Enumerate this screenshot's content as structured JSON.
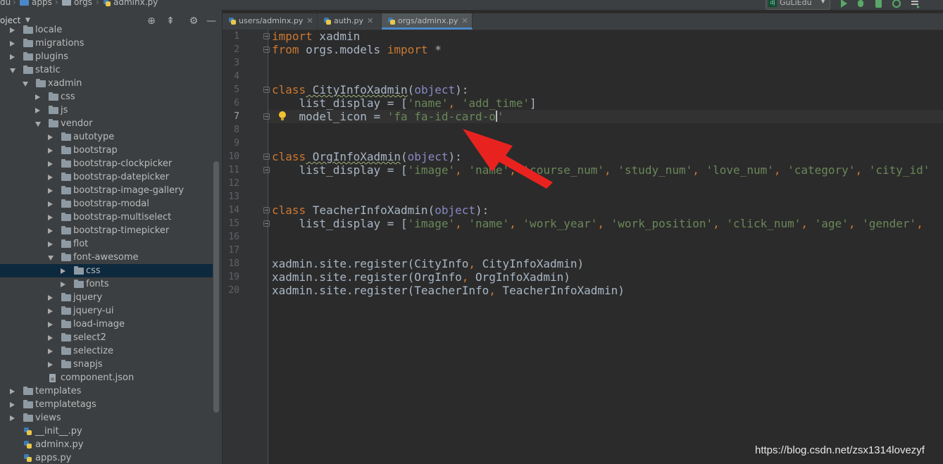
{
  "breadcrumb": {
    "part_0": "du",
    "part_1": "apps",
    "part_2": "orgs",
    "part_3": "adminx.py"
  },
  "toolbar": {
    "run_config": "GuLiEdu"
  },
  "project_panel": {
    "title": "oject",
    "tree": [
      {
        "label": "locale",
        "indent": 1,
        "expand": "right",
        "type": "folder"
      },
      {
        "label": "migrations",
        "indent": 1,
        "expand": "right",
        "type": "folder"
      },
      {
        "label": "plugins",
        "indent": 1,
        "expand": "right",
        "type": "folder"
      },
      {
        "label": "static",
        "indent": 1,
        "expand": "down",
        "type": "folder"
      },
      {
        "label": "xadmin",
        "indent": 2,
        "expand": "down",
        "type": "folder"
      },
      {
        "label": "css",
        "indent": 3,
        "expand": "right",
        "type": "folder"
      },
      {
        "label": "js",
        "indent": 3,
        "expand": "right",
        "type": "folder"
      },
      {
        "label": "vendor",
        "indent": 3,
        "expand": "down",
        "type": "folder"
      },
      {
        "label": "autotype",
        "indent": 4,
        "expand": "right",
        "type": "folder"
      },
      {
        "label": "bootstrap",
        "indent": 4,
        "expand": "right",
        "type": "folder"
      },
      {
        "label": "bootstrap-clockpicker",
        "indent": 4,
        "expand": "right",
        "type": "folder"
      },
      {
        "label": "bootstrap-datepicker",
        "indent": 4,
        "expand": "right",
        "type": "folder"
      },
      {
        "label": "bootstrap-image-gallery",
        "indent": 4,
        "expand": "right",
        "type": "folder"
      },
      {
        "label": "bootstrap-modal",
        "indent": 4,
        "expand": "right",
        "type": "folder"
      },
      {
        "label": "bootstrap-multiselect",
        "indent": 4,
        "expand": "right",
        "type": "folder"
      },
      {
        "label": "bootstrap-timepicker",
        "indent": 4,
        "expand": "right",
        "type": "folder"
      },
      {
        "label": "flot",
        "indent": 4,
        "expand": "right",
        "type": "folder"
      },
      {
        "label": "font-awesome",
        "indent": 4,
        "expand": "down",
        "type": "folder"
      },
      {
        "label": "css",
        "indent": 5,
        "expand": "right",
        "type": "folder",
        "selected": true
      },
      {
        "label": "fonts",
        "indent": 5,
        "expand": "right",
        "type": "folder"
      },
      {
        "label": "jquery",
        "indent": 4,
        "expand": "right",
        "type": "folder"
      },
      {
        "label": "jquery-ui",
        "indent": 4,
        "expand": "right",
        "type": "folder"
      },
      {
        "label": "load-image",
        "indent": 4,
        "expand": "right",
        "type": "folder"
      },
      {
        "label": "select2",
        "indent": 4,
        "expand": "right",
        "type": "folder"
      },
      {
        "label": "selectize",
        "indent": 4,
        "expand": "right",
        "type": "folder"
      },
      {
        "label": "snapjs",
        "indent": 4,
        "expand": "right",
        "type": "folder"
      },
      {
        "label": "component.json",
        "indent": 3,
        "expand": "none",
        "type": "json"
      },
      {
        "label": "templates",
        "indent": 1,
        "expand": "right",
        "type": "folder"
      },
      {
        "label": "templatetags",
        "indent": 1,
        "expand": "right",
        "type": "folder"
      },
      {
        "label": "views",
        "indent": 1,
        "expand": "right",
        "type": "folder"
      },
      {
        "label": "__init__.py",
        "indent": 1,
        "expand": "none",
        "type": "py"
      },
      {
        "label": "adminx.py",
        "indent": 1,
        "expand": "none",
        "type": "py"
      },
      {
        "label": "apps.py",
        "indent": 1,
        "expand": "none",
        "type": "py"
      }
    ]
  },
  "tabs": [
    {
      "label": "users/adminx.py",
      "active": false
    },
    {
      "label": "auth.py",
      "active": false
    },
    {
      "label": "orgs/adminx.py",
      "active": true
    }
  ],
  "editor": {
    "line_numbers": [
      "1",
      "2",
      "3",
      "4",
      "5",
      "6",
      "7",
      "8",
      "9",
      "10",
      "11",
      "12",
      "13",
      "14",
      "15",
      "16",
      "17",
      "18",
      "19",
      "20"
    ],
    "current_line": 7,
    "lines": [
      [
        [
          "kw",
          "import"
        ],
        [
          "id",
          " xadmin"
        ]
      ],
      [
        [
          "kw",
          "from"
        ],
        [
          "id",
          " orgs.models "
        ],
        [
          "kw",
          "import"
        ],
        [
          "id",
          " *"
        ]
      ],
      [],
      [],
      [
        [
          "kw",
          "class"
        ],
        [
          "cls",
          " CityInfoXadmin"
        ],
        [
          "id",
          "("
        ],
        [
          "bi",
          "object"
        ],
        [
          "id",
          "):"
        ]
      ],
      [
        [
          "id",
          "    list_display = ["
        ],
        [
          "str",
          "'name'"
        ],
        [
          "pun",
          ", "
        ],
        [
          "str",
          "'add_time'"
        ],
        [
          "id",
          "]"
        ]
      ],
      [
        [
          "id",
          "    model_icon = "
        ],
        [
          "str",
          "'fa fa-id-card-o"
        ],
        [
          "caret",
          ""
        ],
        [
          "str",
          "'"
        ]
      ],
      [],
      [],
      [
        [
          "kw",
          "class"
        ],
        [
          "cls",
          " OrgInfoXadmin"
        ],
        [
          "id",
          "("
        ],
        [
          "bi",
          "object"
        ],
        [
          "id",
          "):"
        ]
      ],
      [
        [
          "id",
          "    list_display = ["
        ],
        [
          "str",
          "'image'"
        ],
        [
          "pun",
          ", "
        ],
        [
          "str",
          "'name'"
        ],
        [
          "pun",
          ", "
        ],
        [
          "str",
          "'course_num'"
        ],
        [
          "pun",
          ", "
        ],
        [
          "str",
          "'study_num'"
        ],
        [
          "pun",
          ", "
        ],
        [
          "str",
          "'love_num'"
        ],
        [
          "pun",
          ", "
        ],
        [
          "str",
          "'category'"
        ],
        [
          "pun",
          ", "
        ],
        [
          "str",
          "'city_id'"
        ]
      ],
      [],
      [],
      [
        [
          "kw",
          "class"
        ],
        [
          "cls",
          " TeacherInfoXadmin"
        ],
        [
          "id",
          "("
        ],
        [
          "bi",
          "object"
        ],
        [
          "id",
          "):"
        ]
      ],
      [
        [
          "id",
          "    list_display = ["
        ],
        [
          "str",
          "'image'"
        ],
        [
          "pun",
          ", "
        ],
        [
          "str",
          "'name'"
        ],
        [
          "pun",
          ", "
        ],
        [
          "str",
          "'work_year'"
        ],
        [
          "pun",
          ", "
        ],
        [
          "str",
          "'work_position'"
        ],
        [
          "pun",
          ", "
        ],
        [
          "str",
          "'click_num'"
        ],
        [
          "pun",
          ", "
        ],
        [
          "str",
          "'age'"
        ],
        [
          "pun",
          ", "
        ],
        [
          "str",
          "'gender'"
        ],
        [
          "pun",
          ","
        ]
      ],
      [],
      [],
      [
        [
          "id",
          "xadmin.site.register(CityInfo"
        ],
        [
          "pun",
          ", "
        ],
        [
          "id",
          "CityInfoXadmin)"
        ]
      ],
      [
        [
          "id",
          "xadmin.site.register(OrgInfo"
        ],
        [
          "pun",
          ", "
        ],
        [
          "id",
          "OrgInfoXadmin)"
        ]
      ],
      [
        [
          "id",
          "xadmin.site.register(TeacherInfo"
        ],
        [
          "pun",
          ", "
        ],
        [
          "id",
          "TeacherInfoXadmin)"
        ]
      ]
    ]
  },
  "watermark": "https://blog.csdn.net/zsx1314lovezyf",
  "colors": {
    "annotation_arrow": "#e8231f",
    "selection": "#0d293e",
    "tab_underline": "#4a88c7"
  }
}
